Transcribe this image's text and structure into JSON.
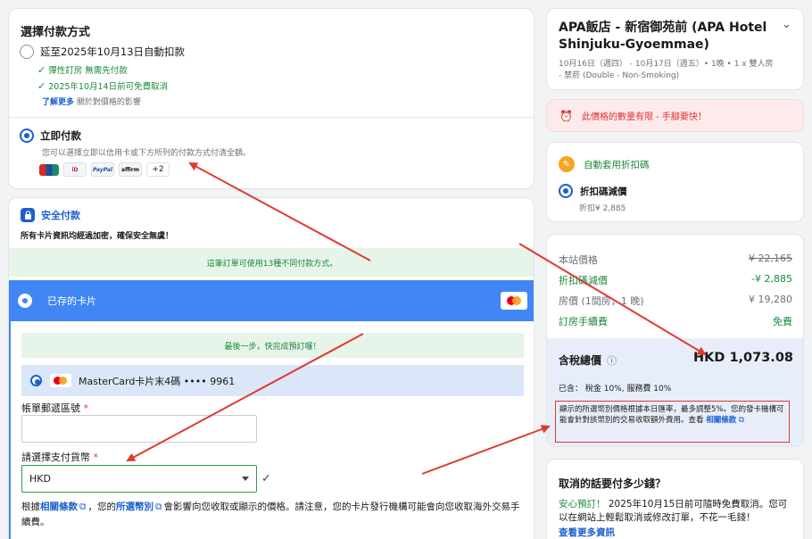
{
  "payment_method": {
    "title": "選擇付款方式",
    "auto_pay_label": "延至2025年10月13日自動扣款",
    "benefit_1": "彈性訂房 無需先付款",
    "benefit_2": "2025年10月14日前可免費取消",
    "learn_more_link": "了解更多",
    "learn_more_suffix": "關於對價格的影響",
    "pay_now_label": "立即付款",
    "pay_now_desc": "您可以選擇立即以信用卡或下方所列的付款方式付清全額。",
    "logos": [
      "UnionPay",
      "iD",
      "PayPal",
      "affirm"
    ],
    "more_count": "+2"
  },
  "secure": {
    "title": "安全付款",
    "desc": "所有卡片資訊均經過加密，確保安全無虞！",
    "methods_banner": "這筆訂單可使用13種不同付款方式。",
    "saved_cards_label": "已存的卡片",
    "final_step_banner": "最後一步，快完成預訂囉！",
    "card_label": "MasterCard卡片末4碼 •••• 9961",
    "postal_label": "帳單郵遞區號",
    "postal_value": "",
    "currency_label": "請選擇支付貨幣",
    "currency_value": "HKD",
    "required_mark": "*",
    "note_prefix": "根據",
    "note_link_1": "相關條款",
    "note_mid": "，您的",
    "note_link_2": "所選幣別",
    "note_suffix": "會影響向您收取或顯示的價格。請注意，您的卡片發行機構可能會向您收取海外交易手續費。"
  },
  "hotel": {
    "name": "APA飯店 - 新宿御苑前 (APA Hotel Shinjuku-Gyoemmae)",
    "details": "10月16日（週四） - 10月17日（週五）• 1晚 • 1 x 雙人房 - 禁菸 (Double - Non-Smoking)"
  },
  "alert": {
    "text": "此價格的數量有限 - 手腳要快！"
  },
  "promo": {
    "title": "自動套用折扣碼",
    "option_label": "折扣碼減價",
    "option_amount": "折扣¥ 2,885"
  },
  "price": {
    "rows": [
      {
        "label": "本站價格",
        "value": "¥ 22,165"
      },
      {
        "label": "折扣碼減價",
        "value": "-¥ 2,885"
      },
      {
        "label": "房價 (1間房，1 晚)",
        "value": "¥ 19,280"
      },
      {
        "label": "訂房手續費",
        "value": "免費"
      }
    ],
    "total_label": "含稅總價",
    "info_icon": "ⓘ",
    "total_value": "HKD 1,073.08",
    "included": "已含： 稅金 10%, 服務費 10%",
    "notice": "顯示的所選幣別價格根據本日匯率，最多調整5%。您的發卡機構可能會針對該幣別的交易收取額外費用。查看",
    "notice_link": "相關條款"
  },
  "cancel": {
    "title": "取消的話要付多少錢？",
    "text_green": "安心預訂！",
    "text": "2025年10月15日前可隨時免費取消。您可以在網站上輕鬆取消或修改訂單，不花一毛錢！",
    "link": "查看更多資訊"
  },
  "colors": {
    "accent_blue": "#1b5fcf",
    "saved_card_bar": "#4285f4",
    "green": "#1a8a3a",
    "alert_bg": "#fdeaea",
    "annotation_red": "#e03a2f"
  }
}
